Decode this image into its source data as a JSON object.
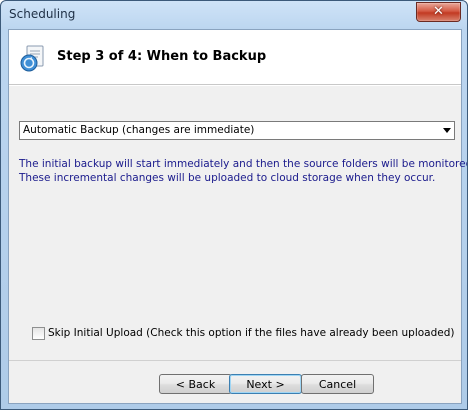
{
  "window": {
    "title": "Scheduling"
  },
  "header": {
    "title": "Step 3 of 4:  When to Backup"
  },
  "schedule": {
    "selected": "Automatic Backup (changes are immediate)"
  },
  "description": {
    "line1": "The initial backup will start immediately and then the source folders will be monitored for changes.",
    "line2": "These incremental changes will be uploaded to cloud storage when they occur."
  },
  "options": {
    "skip_label": "Skip Initial Upload (Check this option if the files have already been uploaded)",
    "skip_checked": false
  },
  "buttons": {
    "back": "< Back",
    "next": "Next >",
    "cancel": "Cancel"
  },
  "colors": {
    "description_text": "#1a1a8c",
    "default_button_border": "#3c7fb1"
  },
  "icons": {
    "close": "close-icon",
    "wizard": "backup-wizard-icon",
    "dropdown": "chevron-down-icon"
  }
}
